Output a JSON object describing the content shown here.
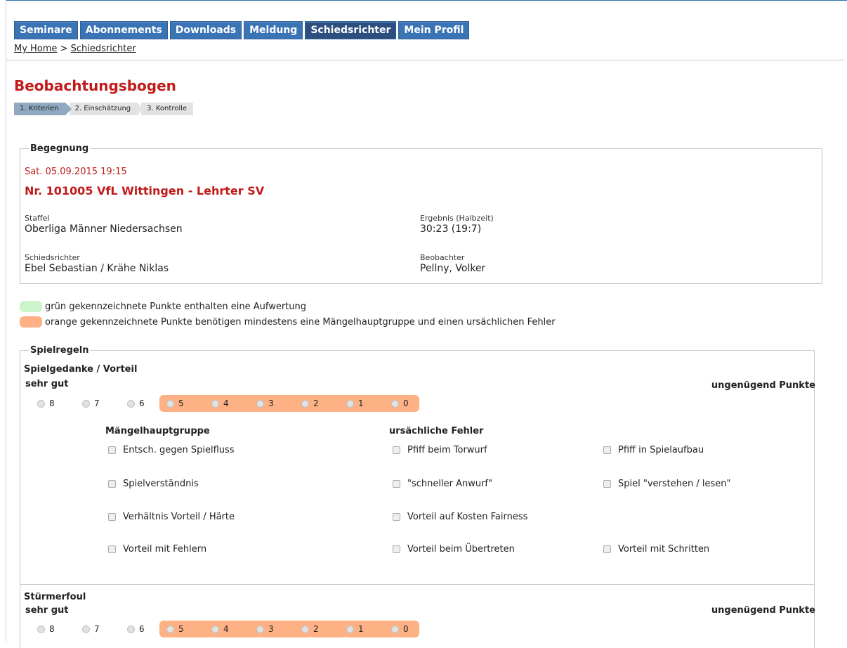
{
  "nav": {
    "items": [
      "Seminare",
      "Abonnements",
      "Downloads",
      "Meldung",
      "Schiedsrichter",
      "Mein Profil"
    ],
    "active": "Schiedsrichter"
  },
  "breadcrumb": {
    "home": "My Home",
    "separator": ">",
    "current": "Schiedsrichter"
  },
  "page": {
    "title": "Beobachtungsbogen"
  },
  "steps": [
    "1. Kriterien",
    "2. Einschätzung",
    "3. Kontrolle"
  ],
  "begegnung": {
    "legend": "Begegnung",
    "datum": "Sat. 05.09.2015 19:15",
    "match": "Nr. 101005 VfL Wittingen - Lehrter SV",
    "staffel_label": "Staffel",
    "staffel_value": "Oberliga Männer Niedersachsen",
    "ergebnis_label": "Ergebnis (Halbzeit)",
    "ergebnis_value": "30:23 (19:7)",
    "schiedsrichter_label": "Schiedsrichter",
    "schiedsrichter_value": "Ebel Sebastian / Krähe Niklas",
    "beobachter_label": "Beobachter",
    "beobachter_value": "Pellny, Volker"
  },
  "legend_notes": {
    "green": "grün gekennzeichnete Punkte enthalten eine Aufwertung",
    "orange": "orange gekennzeichnete Punkte benötigen mindestens eine Mängelhauptgruppe und einen ursächlichen Fehler"
  },
  "spielregeln": {
    "legend": "Spielregeln",
    "sections": [
      {
        "title": "Spielgedanke / Vorteil",
        "best": "sehr gut",
        "worst": "ungenügend Punkte",
        "scores": [
          "8",
          "7",
          "6",
          "5",
          "4",
          "3",
          "2",
          "1",
          "0"
        ],
        "group_head": "Mängelhauptgruppe",
        "cause_head": "ursächliche Fehler",
        "groups": [
          "Entsch. gegen Spielfluss",
          "Spielverständnis",
          "Verhältnis Vorteil / Härte",
          "Vorteil mit Fehlern"
        ],
        "causes_a": [
          "Pfiff beim Torwurf",
          "\"schneller Anwurf\"",
          "Vorteil auf Kosten Fairness",
          "Vorteil beim Übertreten"
        ],
        "causes_b": [
          "Pfiff in Spielaufbau",
          "Spiel \"verstehen / lesen\"",
          "",
          "Vorteil mit Schritten"
        ]
      },
      {
        "title": "Stürmerfoul",
        "best": "sehr gut",
        "worst": "ungenügend Punkte",
        "scores": [
          "8",
          "7",
          "6",
          "5",
          "4",
          "3",
          "2",
          "1",
          "0"
        ]
      }
    ]
  },
  "colors": {
    "nav": "#3a74b5",
    "nav_active": "#2d4f80",
    "title_red": "#c21a1a",
    "orange": "#fdb184",
    "green": "#ccf5cc"
  }
}
